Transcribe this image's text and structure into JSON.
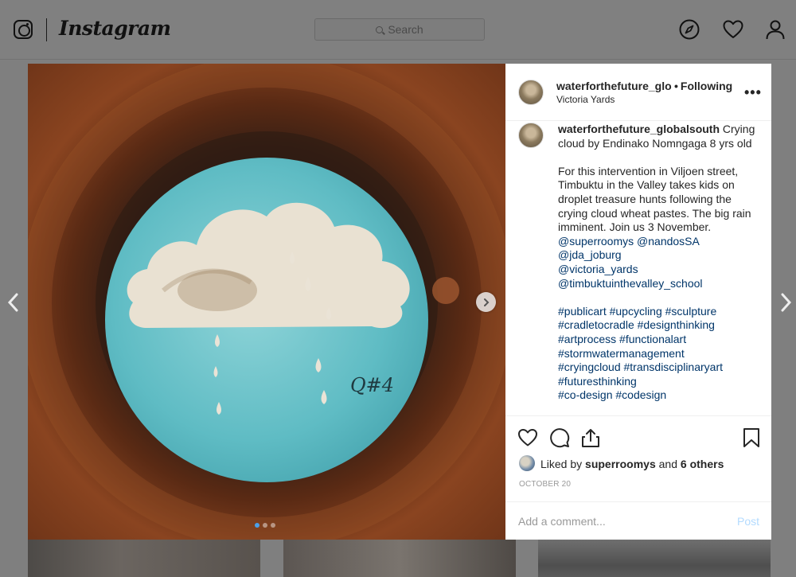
{
  "nav": {
    "brand": "Instagram",
    "search_placeholder": "Search"
  },
  "post": {
    "username": "waterforthefuture_globalsouth",
    "follow_separator": "•",
    "follow_status": "Following",
    "location": "Victoria Yards",
    "caption_title": "Crying cloud by Endinako Nomngaga 8 yrs old",
    "caption_body": "For this intervention in Viljoen street, Timbuktu in the Valley takes kids on droplet treasure hunts following the crying cloud wheat pastes. The big rain imminent. Join us 3 November.",
    "mentions_line1": [
      "@superroomys",
      "@nandosSA"
    ],
    "mentions": [
      "@jda_joburg",
      "@victoria_yards",
      "@timbuktuinthevalley_school"
    ],
    "hashtag_lines": [
      [
        "#publicart",
        "#upcycling",
        "#sculpture"
      ],
      [
        "#cradletocradle",
        "#designthinking"
      ],
      [
        "#artprocess",
        "#functionalart"
      ],
      [
        "#stormwatermanagement"
      ],
      [
        "#cryingcloud",
        "#transdisciplinaryart"
      ],
      [
        "#futuresthinking"
      ],
      [
        "#co-design",
        "#codesign"
      ]
    ],
    "likes_prefix": "Liked by",
    "liked_by": "superroomys",
    "likes_and": "and",
    "likes_others": "6 others",
    "date": "October 20",
    "carousel": {
      "total": 3,
      "current": 1
    }
  },
  "comment_box": {
    "placeholder": "Add a comment...",
    "post_label": "Post"
  },
  "icons": {
    "brand": "instagram-glyph-icon",
    "explore": "compass-icon",
    "activity": "heart-icon",
    "profile": "person-icon",
    "more": "ellipsis-icon",
    "like": "heart-outline-icon",
    "comment": "comment-bubble-icon",
    "share": "share-icon",
    "save": "bookmark-icon"
  },
  "colors": {
    "link": "#003569",
    "post_button_disabled": "#b3dbff",
    "overlay": "#7f7f7f",
    "active_dot": "#4a9fe8"
  }
}
